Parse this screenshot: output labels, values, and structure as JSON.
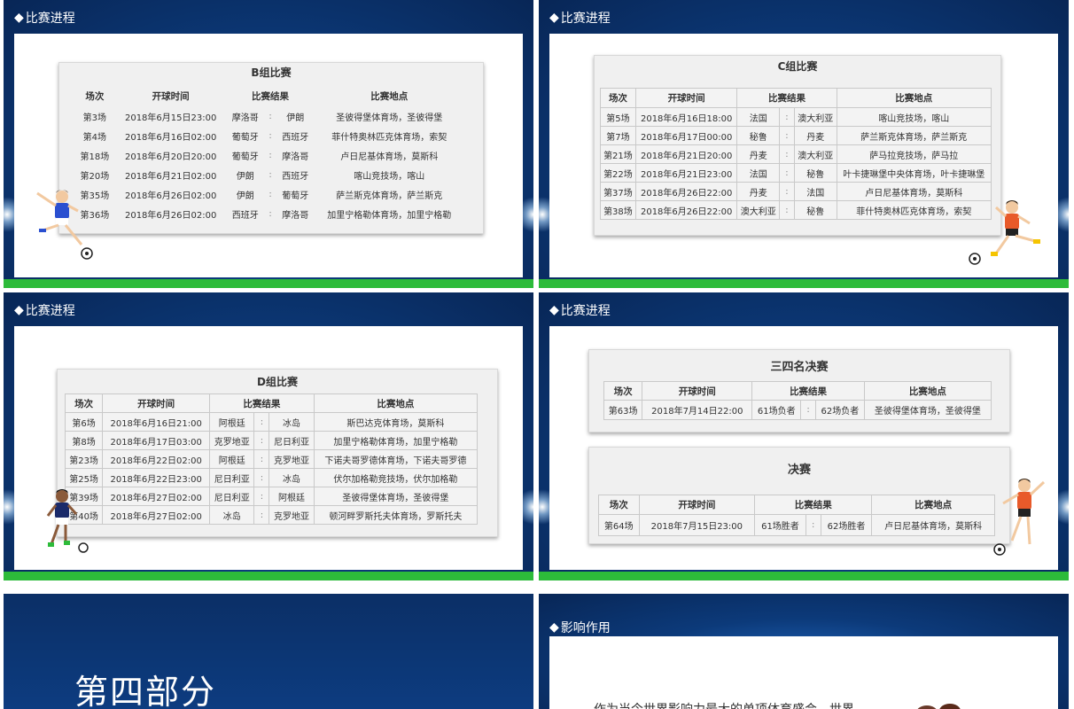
{
  "slides": {
    "s1": {
      "header": "比赛进程",
      "title": "B组比赛",
      "columns": [
        "场次",
        "开球时间",
        "比赛结果",
        "比赛地点"
      ],
      "rows": [
        [
          "第3场",
          "2018年6月15日23:00",
          "摩洛哥",
          ":",
          "伊朗",
          "圣彼得堡体育场，圣彼得堡"
        ],
        [
          "第4场",
          "2018年6月16日02:00",
          "葡萄牙",
          ":",
          "西班牙",
          "菲什特奥林匹克体育场，索契"
        ],
        [
          "第18场",
          "2018年6月20日20:00",
          "葡萄牙",
          ":",
          "摩洛哥",
          "卢日尼基体育场，莫斯科"
        ],
        [
          "第20场",
          "2018年6月21日02:00",
          "伊朗",
          ":",
          "西班牙",
          "喀山竞技场，喀山"
        ],
        [
          "第35场",
          "2018年6月26日02:00",
          "伊朗",
          ":",
          "葡萄牙",
          "萨兰斯克体育场，萨兰斯克"
        ],
        [
          "第36场",
          "2018年6月26日02:00",
          "西班牙",
          ":",
          "摩洛哥",
          "加里宁格勒体育场，加里宁格勒"
        ]
      ]
    },
    "s2": {
      "header": "比赛进程",
      "title": "C组比赛",
      "columns": [
        "场次",
        "开球时间",
        "比赛结果",
        "比赛地点"
      ],
      "rows": [
        [
          "第5场",
          "2018年6月16日18:00",
          "法国",
          ":",
          "澳大利亚",
          "喀山竞技场，喀山"
        ],
        [
          "第7场",
          "2018年6月17日00:00",
          "秘鲁",
          ":",
          "丹麦",
          "萨兰斯克体育场，萨兰斯克"
        ],
        [
          "第21场",
          "2018年6月21日20:00",
          "丹麦",
          ":",
          "澳大利亚",
          "萨马拉竞技场，萨马拉"
        ],
        [
          "第22场",
          "2018年6月21日23:00",
          "法国",
          ":",
          "秘鲁",
          "叶卡捷琳堡中央体育场，叶卡捷琳堡"
        ],
        [
          "第37场",
          "2018年6月26日22:00",
          "丹麦",
          ":",
          "法国",
          "卢日尼基体育场，莫斯科"
        ],
        [
          "第38场",
          "2018年6月26日22:00",
          "澳大利亚",
          ":",
          "秘鲁",
          "菲什特奥林匹克体育场，索契"
        ]
      ]
    },
    "s3": {
      "header": "比赛进程",
      "title": "D组比赛",
      "columns": [
        "场次",
        "开球时间",
        "比赛结果",
        "比赛地点"
      ],
      "rows": [
        [
          "第6场",
          "2018年6月16日21:00",
          "阿根廷",
          ":",
          "冰岛",
          "斯巴达克体育场，莫斯科"
        ],
        [
          "第8场",
          "2018年6月17日03:00",
          "克罗地亚",
          ":",
          "尼日利亚",
          "加里宁格勒体育场，加里宁格勒"
        ],
        [
          "第23场",
          "2018年6月22日02:00",
          "阿根廷",
          ":",
          "克罗地亚",
          "下诺夫哥罗德体育场，下诺夫哥罗德"
        ],
        [
          "第25场",
          "2018年6月22日23:00",
          "尼日利亚",
          ":",
          "冰岛",
          "伏尔加格勒竞技场，伏尔加格勒"
        ],
        [
          "第39场",
          "2018年6月27日02:00",
          "尼日利亚",
          ":",
          "阿根廷",
          "圣彼得堡体育场，圣彼得堡"
        ],
        [
          "第40场",
          "2018年6月27日02:00",
          "冰岛",
          ":",
          "克罗地亚",
          "顿河畔罗斯托夫体育场，罗斯托夫"
        ]
      ]
    },
    "s4": {
      "header": "比赛进程",
      "third": {
        "title": "三四名决赛",
        "columns": [
          "场次",
          "开球时间",
          "比赛结果",
          "比赛地点"
        ],
        "row": [
          "第63场",
          "2018年7月14日22:00",
          "61场负者",
          ":",
          "62场负者",
          "圣彼得堡体育场，圣彼得堡"
        ]
      },
      "final": {
        "title": "决赛",
        "columns": [
          "场次",
          "开球时间",
          "比赛结果",
          "比赛地点"
        ],
        "row": [
          "第64场",
          "2018年7月15日23:00",
          "61场胜者",
          ":",
          "62场胜者",
          "卢日尼基体育场，莫斯科"
        ]
      }
    },
    "s5": {
      "title": "第四部分"
    },
    "s6": {
      "header": "影响作用",
      "text": "作为当今世界影响力最大的单项体育盛会，世界"
    }
  },
  "colors": {
    "navy": "#0a2a5e",
    "stripe": "#2dbb3a",
    "panel": "#ffffff"
  }
}
